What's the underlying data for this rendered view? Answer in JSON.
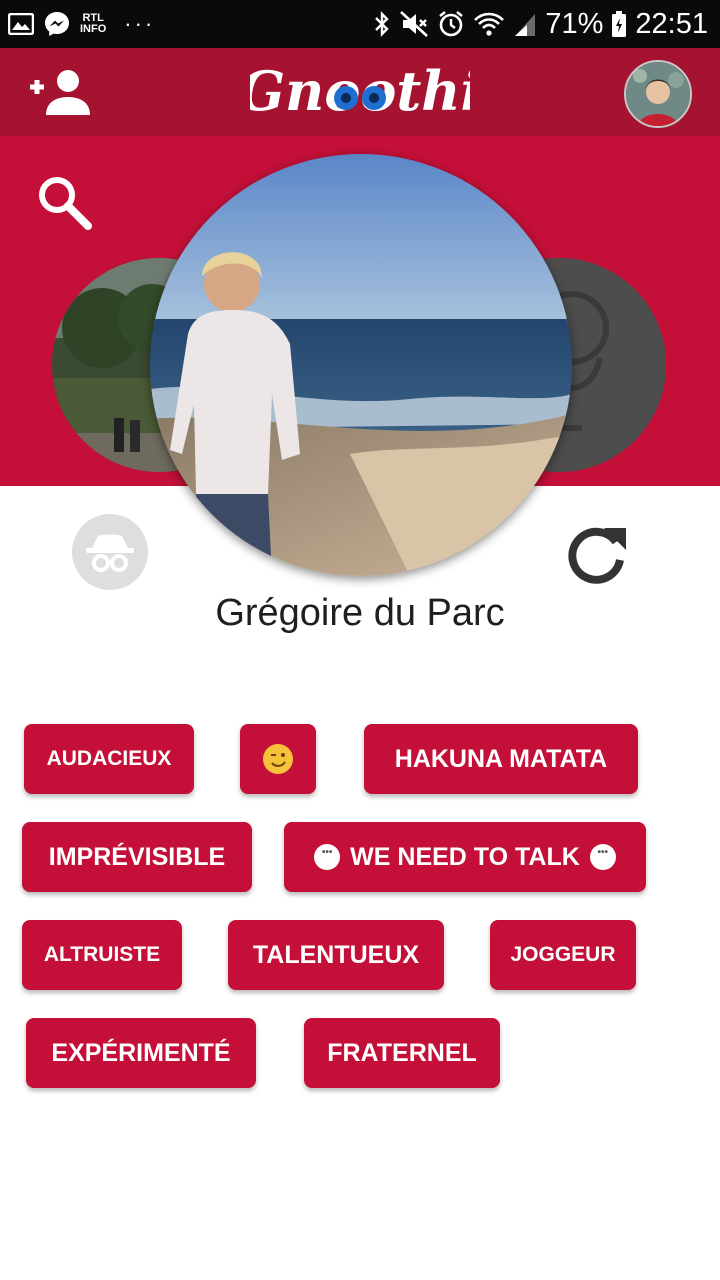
{
  "status_bar": {
    "left_icons": [
      "gallery-icon",
      "messenger-icon",
      "rtl-info-icon",
      "more-dots-icon"
    ],
    "rtl_line1": "RTL",
    "rtl_line2": "INFO",
    "dots": "···",
    "right_icons": [
      "bluetooth-icon",
      "mute-icon",
      "alarm-icon",
      "wifi-icon",
      "signal-icon",
      "battery-icon"
    ],
    "battery": "71%",
    "time": "22:51"
  },
  "header": {
    "app_name": "Gnoothi",
    "add_user_icon": "add-person-icon",
    "profile_avatar": "user-avatar"
  },
  "carousel": {
    "search_icon": "search-icon",
    "current_profile": {
      "name": "Grégoire du Parc"
    }
  },
  "actions": {
    "incognito_icon": "incognito-icon",
    "refresh_icon": "refresh-icon"
  },
  "tags": [
    {
      "label": "AUDACIEUX"
    },
    {
      "label": "😉"
    },
    {
      "label": "HAKUNA MATATA"
    },
    {
      "label": "IMPRÉVISIBLE"
    },
    {
      "label": "WE NEED TO TALK"
    },
    {
      "label": "ALTRUISTE"
    },
    {
      "label": "TALENTUEUX"
    },
    {
      "label": "JOGGEUR"
    },
    {
      "label": "EXPÉRIMENTÉ"
    },
    {
      "label": "FRATERNEL"
    }
  ],
  "colors": {
    "header_bg": "#a51330",
    "band_bg": "#c41038",
    "tag_bg": "#c41038"
  }
}
